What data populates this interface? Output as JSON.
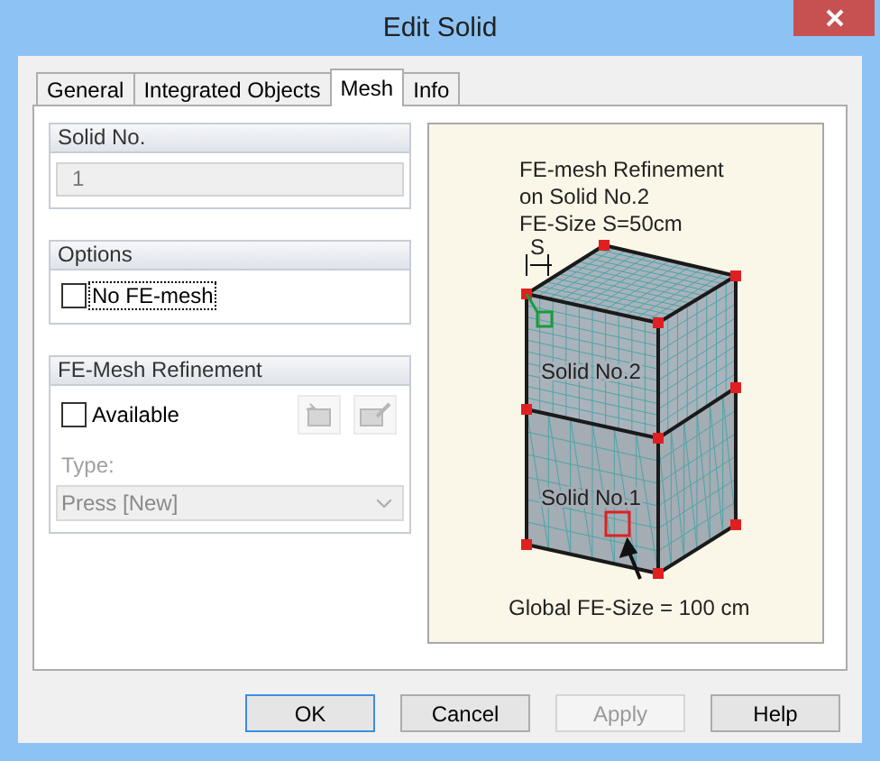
{
  "window": {
    "title": "Edit Solid"
  },
  "tabs": [
    {
      "label": "General",
      "selected": false
    },
    {
      "label": "Integrated Objects",
      "selected": false
    },
    {
      "label": "Mesh",
      "selected": true
    },
    {
      "label": "Info",
      "selected": false
    }
  ],
  "solid_no": {
    "title": "Solid No.",
    "value": "1"
  },
  "options": {
    "title": "Options",
    "items": [
      {
        "label": "No FE-mesh",
        "checked": false,
        "focused": true
      }
    ]
  },
  "refinement": {
    "title": "FE-Mesh Refinement",
    "available": {
      "label": "Available",
      "checked": false
    },
    "type_label": "Type:",
    "type_value": "Press [New]",
    "disabled": true
  },
  "figure": {
    "caption_lines": [
      "FE-mesh Refinement",
      "on Solid No.2",
      "FE-Size S=50cm"
    ],
    "dimension": "S",
    "upper_label": "Solid No.2",
    "lower_label": "Solid No.1",
    "global_label": "Global FE-Size = 100 cm"
  },
  "buttons": [
    {
      "label": "OK",
      "disabled": false,
      "default": true
    },
    {
      "label": "Cancel",
      "disabled": false,
      "default": false
    },
    {
      "label": "Apply",
      "disabled": true,
      "default": false
    },
    {
      "label": "Help",
      "disabled": false,
      "default": false
    }
  ]
}
